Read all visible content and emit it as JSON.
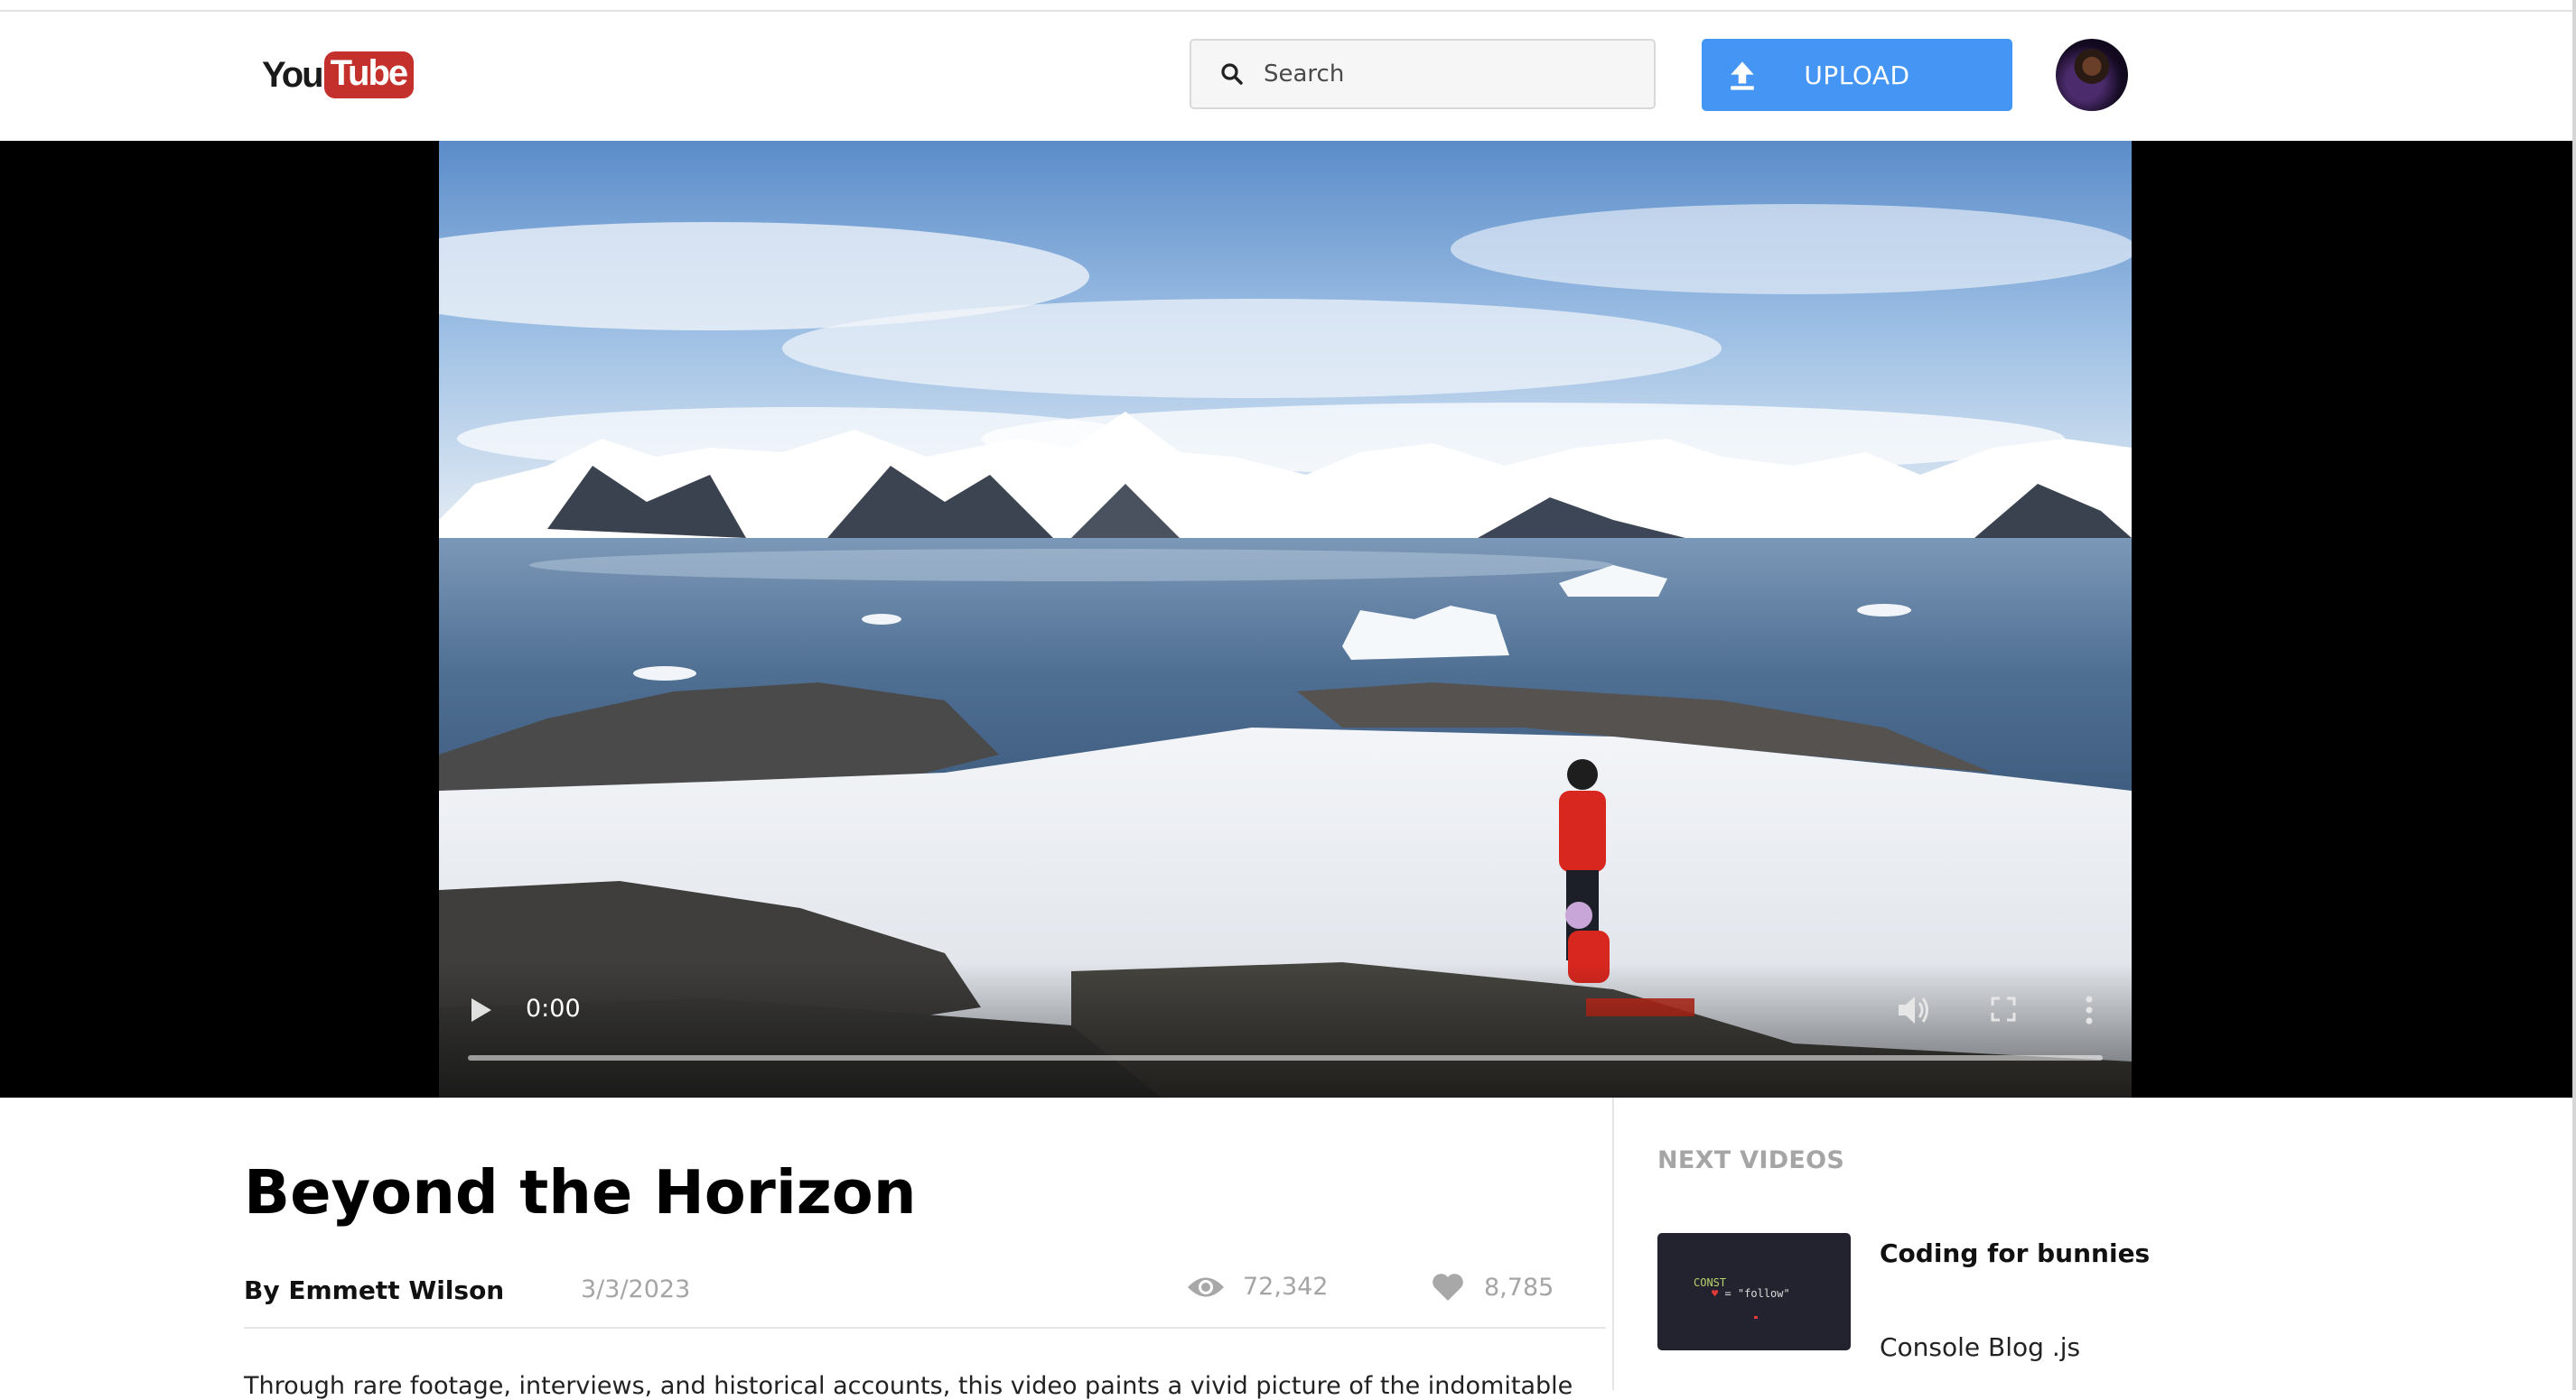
{
  "header": {
    "logo": {
      "you": "You",
      "tube": "Tube"
    },
    "search": {
      "placeholder": "Search"
    },
    "upload_label": "UPLOAD"
  },
  "player": {
    "time": "0:00",
    "progress": 0
  },
  "video": {
    "title": "Beyond the Horizon",
    "author": "By Emmett Wilson",
    "date": "3/3/2023",
    "views": "72,342",
    "likes": "8,785",
    "description": "Through rare footage, interviews, and historical accounts, this video paints a vivid picture of the indomitable"
  },
  "sidebar": {
    "heading": "NEXT VIDEOS",
    "items": [
      {
        "title": "Coding for bunnies",
        "channel": "Console Blog .js",
        "thumb_line1": "CONST",
        "thumb_line2": "\"follow\""
      }
    ]
  },
  "colors": {
    "brand_red": "#c4302b",
    "upload_blue": "#4596f4"
  }
}
